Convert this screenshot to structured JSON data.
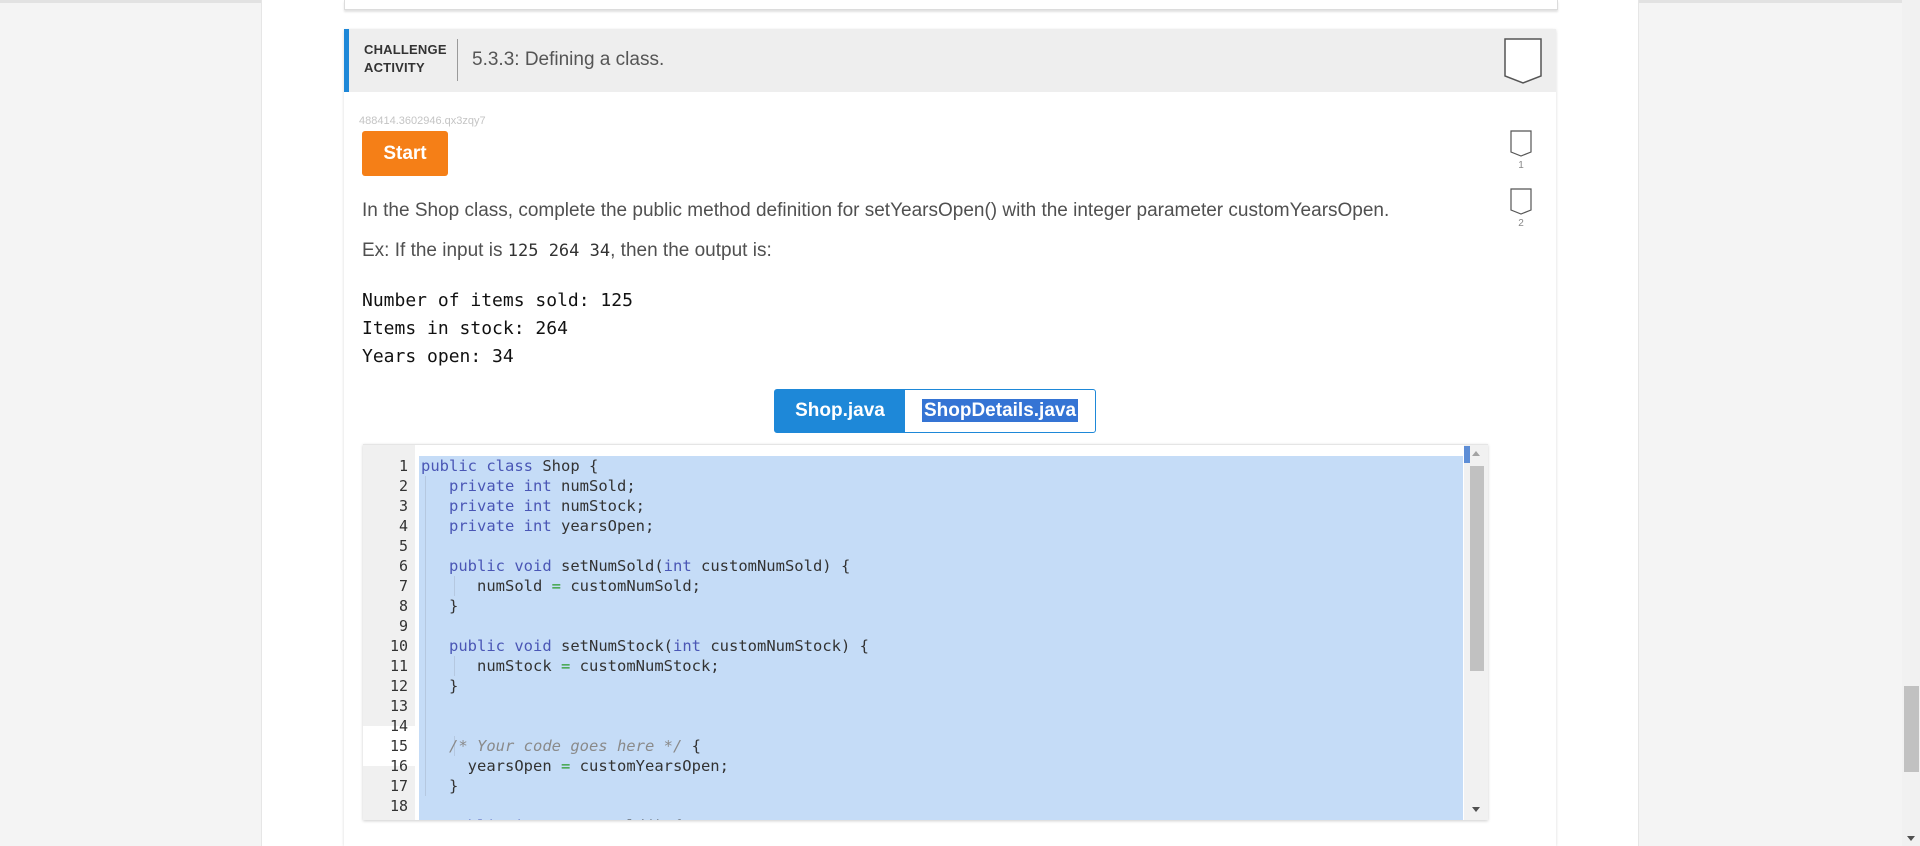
{
  "activity": {
    "label_line1": "CHALLENGE",
    "label_line2": "ACTIVITY",
    "title": "5.3.3: Defining a class.",
    "id": "488414.3602946.qx3zqy7"
  },
  "start_label": "Start",
  "progress": [
    {
      "num": "1"
    },
    {
      "num": "2"
    }
  ],
  "instruction": "In the Shop class, complete the public method definition for setYearsOpen() with the integer parameter customYearsOpen.",
  "example": {
    "prefix": "Ex: If the input is ",
    "input": "125 264 34",
    "suffix": ", then the output is:"
  },
  "expected_output": "Number of items sold: 125\nItems in stock: 264\nYears open: 34",
  "tabs": [
    {
      "label": "Shop.java",
      "active": true
    },
    {
      "label": "ShopDetails.java",
      "active": false,
      "selected": true
    }
  ],
  "editor": {
    "line_numbers": [
      "1",
      "2",
      "3",
      "4",
      "5",
      "6",
      "7",
      "8",
      "9",
      "10",
      "11",
      "12",
      "13",
      "14",
      "15",
      "16",
      "17",
      "18"
    ]
  },
  "colors": {
    "accent": "#1e88d8",
    "start": "#f57f17",
    "selection": "#c5dcf7"
  }
}
